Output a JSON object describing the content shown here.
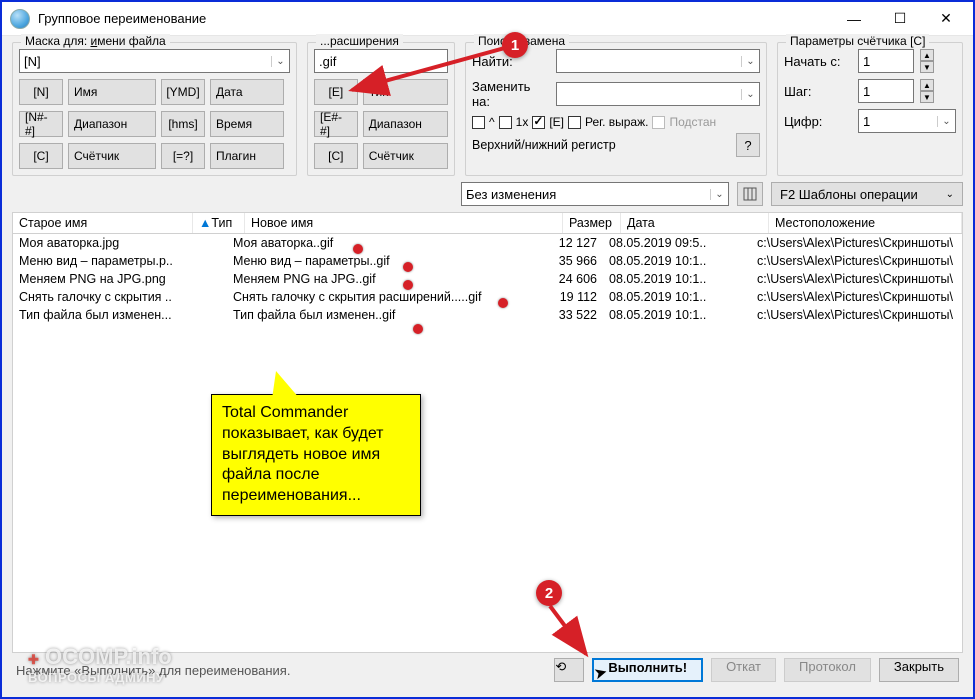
{
  "window": {
    "title": "Групповое переименование"
  },
  "mask": {
    "group_label_prefix": "Маска для: ",
    "group_label_underline": "и",
    "group_label_suffix": "мени файла",
    "value": "[N]",
    "btn_n": "[N]",
    "btn_n_label": "Имя",
    "btn_ymd": "[YMD]",
    "btn_ymd_label": "Дата",
    "btn_range": "[N#-#]",
    "btn_range_label": "Диапазон",
    "btn_hms": "[hms]",
    "btn_hms_label": "Время",
    "btn_c": "[C]",
    "btn_c_label": "Счётчик",
    "btn_plugin": "[=?]",
    "btn_plugin_label": "Плагин"
  },
  "ext": {
    "group_label": "...расширения",
    "value": ".gif",
    "btn_e": "[E]",
    "btn_e_label": "Тип",
    "btn_range": "[E#-#]",
    "btn_range_label": "Диапазон",
    "btn_c": "[C]",
    "btn_c_label": "Счётчик"
  },
  "search": {
    "group_label": "Поиск и замена",
    "find_label": "Найти:",
    "find_value": "",
    "replace_label": "Заменить на:",
    "replace_value": "",
    "chk_caret": "^",
    "chk_1x": "1x",
    "chk_e": "[E]",
    "chk_regex": "Рег. выраж.",
    "chk_subst": "Подстан",
    "case_hint": "Верхний/нижний регистр",
    "case_value": "Без изменения"
  },
  "counter": {
    "group_label": "Параметры счётчика [C]",
    "start_label": "Начать с:",
    "start_value": "1",
    "step_label": "Шаг:",
    "step_value": "1",
    "digits_label": "Цифр:",
    "digits_value": "1",
    "templates_label": "F2 Шаблоны операции"
  },
  "table": {
    "hdr_old": "Старое имя",
    "hdr_type": "Тип",
    "hdr_new": "Новое имя",
    "hdr_size": "Размер",
    "hdr_date": "Дата",
    "hdr_loc": "Местоположение",
    "rows": [
      {
        "old": "Моя аваторка.jpg",
        "new": "Моя аваторка..gif",
        "size": "12 127",
        "date": "08.05.2019 09:5..",
        "loc": "c:\\Users\\Alex\\Pictures\\Скриншоты\\"
      },
      {
        "old": "Меню вид – параметры.p..",
        "new": "Меню вид – параметры..gif",
        "size": "35 966",
        "date": "08.05.2019 10:1..",
        "loc": "c:\\Users\\Alex\\Pictures\\Скриншоты\\"
      },
      {
        "old": "Меняем PNG на JPG.png",
        "new": "Меняем PNG на JPG..gif",
        "size": "24 606",
        "date": "08.05.2019 10:1..",
        "loc": "c:\\Users\\Alex\\Pictures\\Скриншоты\\"
      },
      {
        "old": "Снять галочку с скрытия ..",
        "new": "Снять галочку с скрытия расширений.....gif",
        "size": "19 112",
        "date": "08.05.2019 10:1..",
        "loc": "c:\\Users\\Alex\\Pictures\\Скриншоты\\"
      },
      {
        "old": "Тип файла был изменен...",
        "new": "Тип файла был изменен..gif",
        "size": "33 522",
        "date": "08.05.2019 10:1..",
        "loc": "c:\\Users\\Alex\\Pictures\\Скриншоты\\"
      }
    ]
  },
  "bottom": {
    "hint": "Нажмите «Выполнить» для переименования.",
    "reload": "⟲",
    "run": "Выполнить!",
    "undo": "Откат",
    "protocol": "Протокол",
    "close": "Закрыть"
  },
  "annotations": {
    "marker1": "1",
    "marker2": "2",
    "callout_text": "Total Commander показывает, как будет выглядеть новое имя файла после переименования..."
  },
  "watermark": {
    "main": "OCOMP.info",
    "sub": "ВОПРОСЫ АДМИНУ"
  }
}
